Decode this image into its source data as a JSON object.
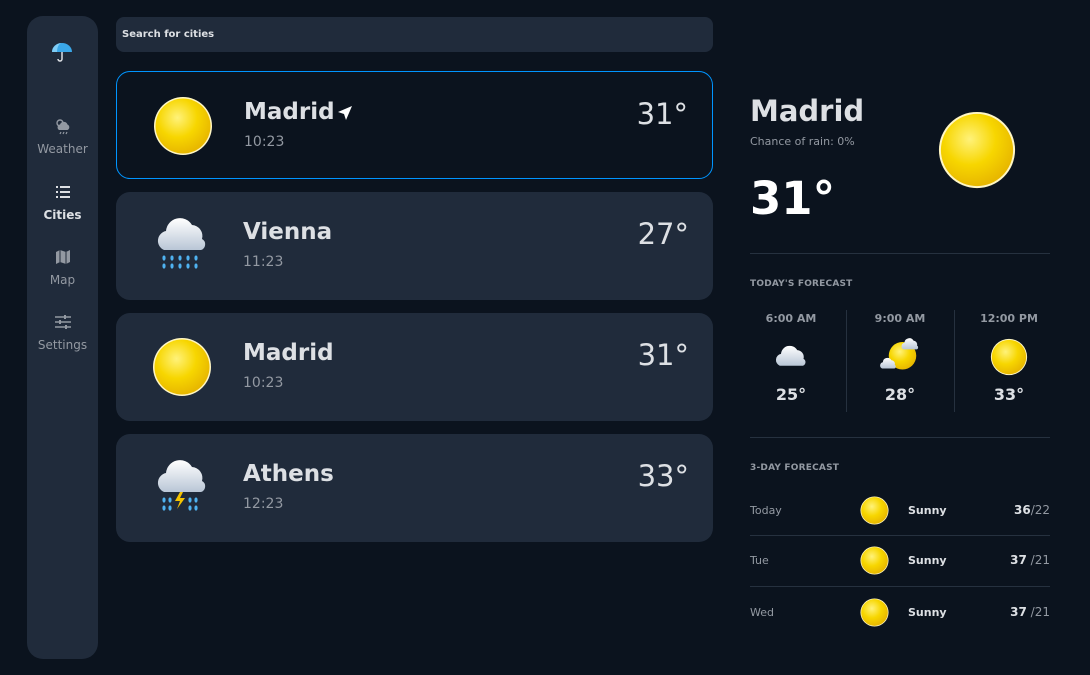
{
  "sidebar": {
    "logo_icon": "umbrella-icon",
    "items": [
      {
        "label": "Weather",
        "icon": "cloud-sun-rain-icon",
        "active": false
      },
      {
        "label": "Cities",
        "icon": "list-icon",
        "active": true
      },
      {
        "label": "Map",
        "icon": "map-icon",
        "active": false
      },
      {
        "label": "Settings",
        "icon": "sliders-icon",
        "active": false
      }
    ]
  },
  "search": {
    "placeholder": "Search for cities"
  },
  "cities": [
    {
      "name": "Madrid",
      "time": "10:23",
      "temp": "31°",
      "icon": "sun-icon",
      "selected": true,
      "current_location": true
    },
    {
      "name": "Vienna",
      "time": "11:23",
      "temp": "27°",
      "icon": "rain-cloud-icon",
      "selected": false
    },
    {
      "name": "Madrid",
      "time": "10:23",
      "temp": "31°",
      "icon": "sun-icon",
      "selected": false
    },
    {
      "name": "Athens",
      "time": "12:23",
      "temp": "33°",
      "icon": "thunder-rain-icon",
      "selected": false
    }
  ],
  "detail": {
    "city": "Madrid",
    "rain": "Chance of rain: 0%",
    "temp": "31°",
    "icon": "sun-icon",
    "today_title": "TODAY'S FORECAST",
    "hours": [
      {
        "time": "6:00 AM",
        "temp": "25°",
        "icon": "cloud-icon"
      },
      {
        "time": "9:00 AM",
        "temp": "28°",
        "icon": "sun-cloud-icon"
      },
      {
        "time": "12:00 PM",
        "temp": "33°",
        "icon": "sun-icon"
      }
    ],
    "three_day_title": "3-DAY FORECAST",
    "days": [
      {
        "day": "Today",
        "condition": "Sunny",
        "high": "36",
        "low": "/22",
        "icon": "sun-icon"
      },
      {
        "day": "Tue",
        "condition": "Sunny",
        "high": "37",
        "low": " /21",
        "icon": "sun-icon"
      },
      {
        "day": "Wed",
        "condition": "Sunny",
        "high": "37",
        "low": " /21",
        "icon": "sun-icon"
      }
    ]
  },
  "colors": {
    "background": "#0b131e",
    "panel": "#202b3b",
    "accent": "#0095ff",
    "sun": "#f5d000",
    "muted_text": "#9399a2"
  }
}
